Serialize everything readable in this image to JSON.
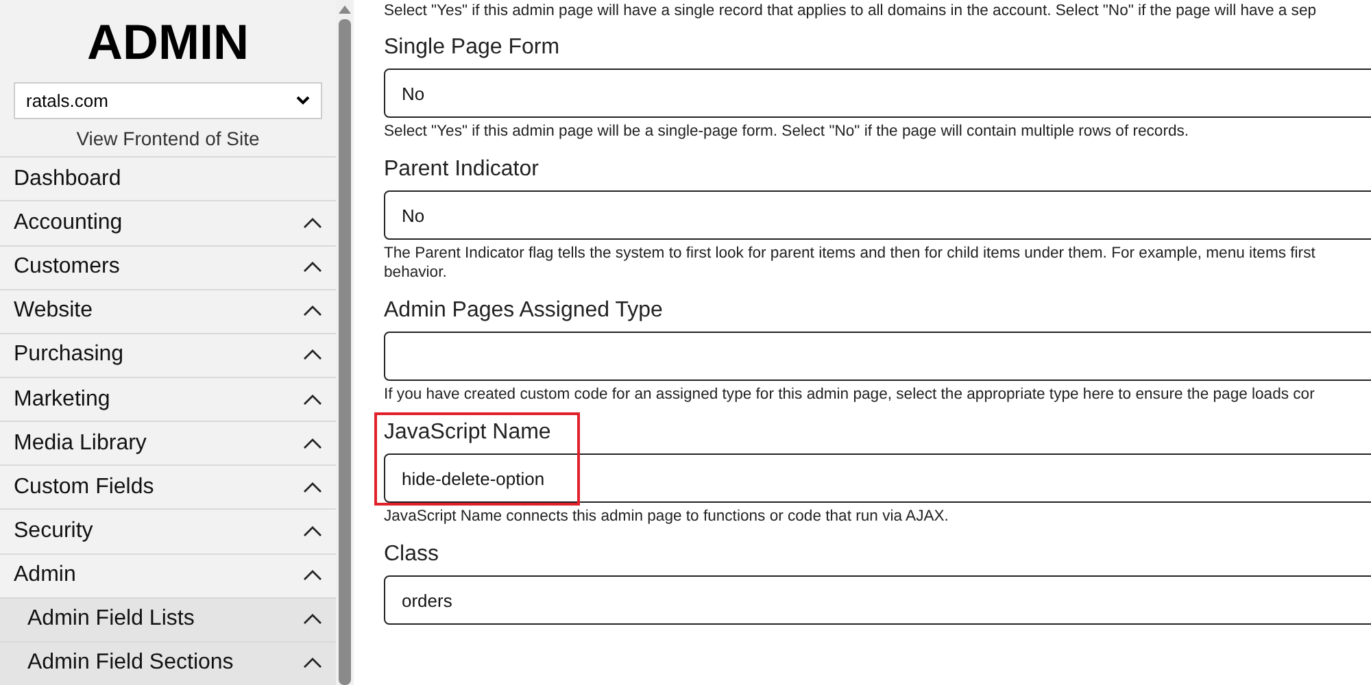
{
  "sidebar": {
    "title": "ADMIN",
    "site_select": {
      "value": "ratals.com"
    },
    "frontend_link": "View Frontend of Site",
    "items": [
      {
        "label": "Dashboard",
        "kind": "link"
      },
      {
        "label": "Accounting",
        "kind": "menu"
      },
      {
        "label": "Customers",
        "kind": "menu"
      },
      {
        "label": "Website",
        "kind": "menu"
      },
      {
        "label": "Purchasing",
        "kind": "menu"
      },
      {
        "label": "Marketing",
        "kind": "menu"
      },
      {
        "label": "Media Library",
        "kind": "menu"
      },
      {
        "label": "Custom Fields",
        "kind": "menu"
      },
      {
        "label": "Security",
        "kind": "menu"
      },
      {
        "label": "Admin",
        "kind": "menu",
        "children": [
          {
            "label": "Admin Field Lists",
            "kind": "menu"
          },
          {
            "label": "Admin Field Sections",
            "kind": "menu"
          }
        ]
      }
    ]
  },
  "form": {
    "intro": "Select \"Yes\" if this admin page will have a single record that applies to all domains in the account. Select \"No\" if the page will have a sep",
    "fields": [
      {
        "label": "Single Page Form",
        "value": "No",
        "highlighted": false,
        "help": [
          "Select \"Yes\" if this admin page will be a single-page form. Select \"No\" if the page will contain multiple rows of records."
        ]
      },
      {
        "label": "Parent Indicator",
        "value": "No",
        "highlighted": false,
        "help": [
          "The Parent Indicator flag tells the system to first look for parent items and then for child items under them. For example, menu items first",
          "behavior."
        ]
      },
      {
        "label": "Admin Pages Assigned Type",
        "highlighted": false,
        "help": [
          "If you have created custom code for an assigned type for this admin page, select the appropriate type here to ensure the page loads cor"
        ]
      },
      {
        "label": "JavaScript Name",
        "value": "hide-delete-option",
        "highlighted": true,
        "help": [
          "JavaScript Name connects this admin page to functions or code that run via AJAX."
        ]
      },
      {
        "label": "Class",
        "value": "orders",
        "highlighted": false
      }
    ]
  }
}
